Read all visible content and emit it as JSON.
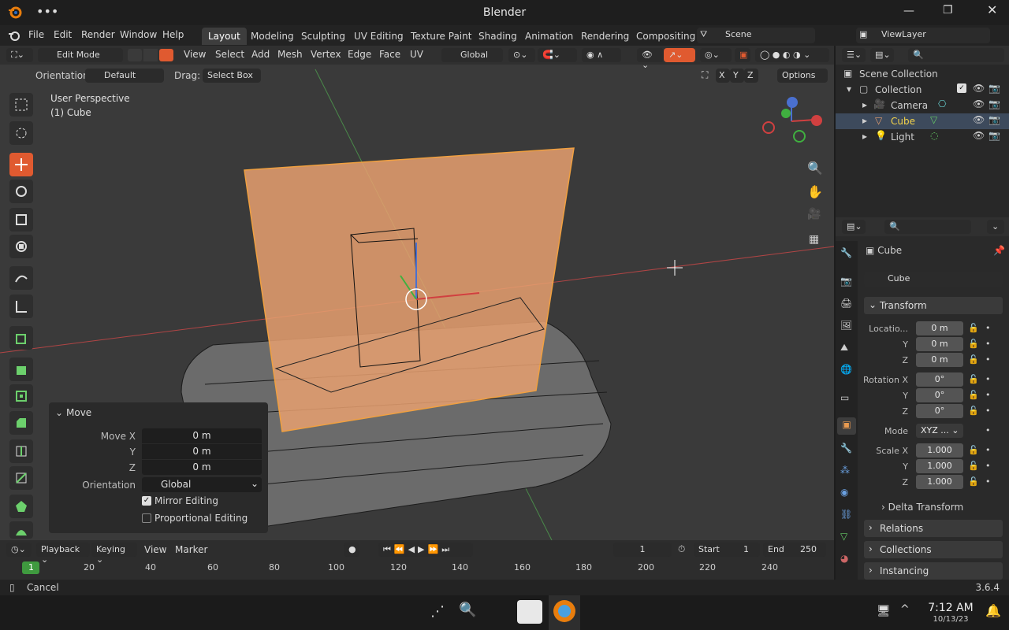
{
  "window": {
    "title": "Blender",
    "dots": "•••"
  },
  "menu": {
    "items": [
      "File",
      "Edit",
      "Render",
      "Window",
      "Help"
    ]
  },
  "workspaces": {
    "tabs": [
      "Layout",
      "Modeling",
      "Sculpting",
      "UV Editing",
      "Texture Paint",
      "Shading",
      "Animation",
      "Rendering",
      "Compositing"
    ],
    "active": "Layout"
  },
  "scene": {
    "name": "Scene",
    "viewlayer": "ViewLayer"
  },
  "header": {
    "mode": "Edit Mode",
    "menus": [
      "View",
      "Select",
      "Add",
      "Mesh",
      "Vertex",
      "Edge",
      "Face",
      "UV"
    ],
    "transform_orientation": "Global"
  },
  "toolsettings": {
    "orientation_label": "Orientation:",
    "orientation_value": "Default",
    "drag_label": "Drag:",
    "drag_value": "Select Box",
    "axes": [
      "X",
      "Y",
      "Z"
    ],
    "options": "Options"
  },
  "viewport": {
    "perspective": "User Perspective",
    "object": "(1) Cube"
  },
  "move_panel": {
    "title": "Move",
    "move_x_label": "Move X",
    "y_label": "Y",
    "z_label": "Z",
    "move_x": "0 m",
    "move_y": "0 m",
    "move_z": "0 m",
    "orientation_label": "Orientation",
    "orientation_value": "Global",
    "mirror_editing": "Mirror Editing",
    "proportional_editing": "Proportional Editing"
  },
  "outliner": {
    "root": "Scene Collection",
    "collection": "Collection",
    "items": [
      {
        "name": "Camera"
      },
      {
        "name": "Cube"
      },
      {
        "name": "Light"
      }
    ]
  },
  "properties": {
    "object_name": "Cube",
    "data_name": "Cube",
    "transform": "Transform",
    "location_label": "Locatio...",
    "rotation_label": "Rotation X",
    "mode_label": "Mode",
    "mode_value": "XYZ ...",
    "scale_label": "Scale X",
    "y": "Y",
    "z": "Z",
    "location": [
      "0 m",
      "0 m",
      "0 m"
    ],
    "rotation": [
      "0°",
      "0°",
      "0°"
    ],
    "scale": [
      "1.000",
      "1.000",
      "1.000"
    ],
    "delta": "Delta Transform",
    "relations": "Relations",
    "collections": "Collections",
    "instancing": "Instancing"
  },
  "timeline": {
    "menus": [
      "Playback",
      "Keying",
      "View",
      "Marker"
    ],
    "current": "1",
    "start_label": "Start",
    "start": "1",
    "end_label": "End",
    "end": "250",
    "ticks": [
      "1",
      "20",
      "40",
      "60",
      "80",
      "100",
      "120",
      "140",
      "160",
      "180",
      "200",
      "220",
      "240"
    ]
  },
  "status": {
    "left": "Cancel",
    "version": "3.6.4"
  },
  "taskbar": {
    "time": "7:12 AM",
    "date": "10/13/23"
  },
  "colors": {
    "accent": "#e05a30",
    "selected_face": "#e8a070",
    "header": "#303030"
  }
}
